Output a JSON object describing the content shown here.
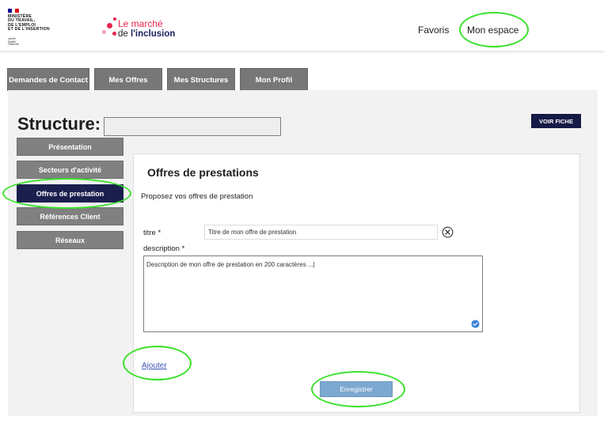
{
  "header": {
    "gov_name": "MINISTÈRE\nDU TRAVAIL,\nDE L'EMPLOI\nET DE L'INSERTION",
    "gov_motto": "Liberté\nÉgalité\nFraternité",
    "brand_line1": "Le marché",
    "brand_line2_prefix": "de ",
    "brand_line2_bold": "l'inclusion",
    "nav_favoris": "Favoris",
    "nav_mon_espace": "Mon espace"
  },
  "tabs": [
    "Demandes de Contact",
    "Mes Offres",
    "Mes Structures",
    "Mon Profil"
  ],
  "structure": {
    "title": "Structure:",
    "name_value": "",
    "voir_fiche": "VOIR FICHE"
  },
  "sidebar": [
    "Présentation",
    "Secteurs d'activité",
    "Offres de prestation",
    "Références Client",
    "Réseaux"
  ],
  "panel": {
    "title": "Offres de prestations",
    "subtitle": "Proposez vos offres de prestation",
    "titre_label": "titre *",
    "titre_value": "Titre de mon offre de prestation",
    "description_label": "description *",
    "description_value": "Description de mon offre de prestation en 200 caractères ...|",
    "ajouter": "Ajouter",
    "save": "Enregistrer"
  },
  "colors": {
    "accent_dark": "#1b1f4e",
    "highlight": "#3be12c",
    "save_button": "#7ca7d0",
    "brand_red": "#e6264a"
  }
}
